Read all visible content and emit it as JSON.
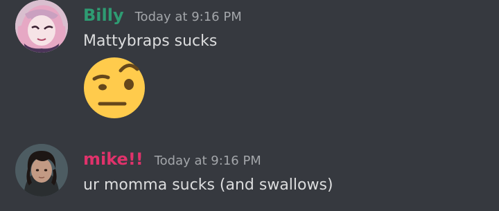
{
  "messages": [
    {
      "username": "Billy",
      "username_color": "#2e9b72",
      "timestamp": "Today at 9:16 PM",
      "text": "Mattybraps sucks",
      "emoji": "face-with-raised-eyebrow-emoji"
    },
    {
      "username": "mike!!",
      "username_color": "#e0326b",
      "timestamp": "Today at 9:16 PM",
      "text": "ur momma sucks (and swallows)"
    }
  ],
  "colors": {
    "background": "#36393f",
    "message_text": "#dcddde",
    "timestamp": "#a3a6aa",
    "emoji_yellow": "#ffcb4c"
  }
}
